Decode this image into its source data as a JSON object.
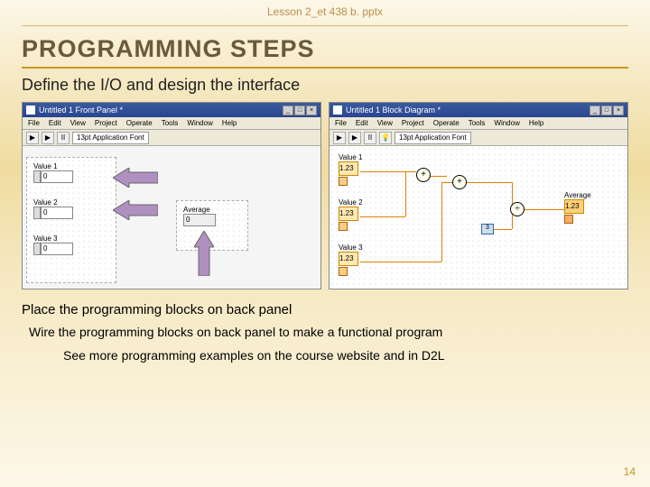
{
  "header": {
    "file": "Lesson 2_et 438 b. pptx"
  },
  "title": "PROGRAMMING STEPS",
  "subtitle": "Define the I/O and design the interface",
  "front": {
    "title": "Untitled 1 Front Panel *",
    "menu": [
      "File",
      "Edit",
      "View",
      "Project",
      "Operate",
      "Tools",
      "Window",
      "Help"
    ],
    "font": "13pt Application Font",
    "v1": {
      "label": "Value 1",
      "val": "0"
    },
    "v2": {
      "label": "Value 2",
      "val": "0"
    },
    "v3": {
      "label": "Value 3",
      "val": "0"
    },
    "avg": {
      "label": "Average",
      "val": "0"
    }
  },
  "block": {
    "title": "Untitled 1 Block Diagram *",
    "menu": [
      "File",
      "Edit",
      "View",
      "Project",
      "Operate",
      "Tools",
      "Window",
      "Help"
    ],
    "font": "13pt Application Font",
    "v1": {
      "label": "Value 1",
      "io": "1.23"
    },
    "v2": {
      "label": "Value 2",
      "io": "1.23"
    },
    "v3": {
      "label": "Value 3",
      "io": "1.23"
    },
    "avg": {
      "label": "Average",
      "io": "1.23"
    },
    "const": "3"
  },
  "captions": {
    "place": "Place the programming blocks on back panel",
    "wire": "Wire the programming blocks on back panel to make a functional program",
    "see": "See more programming examples on the course website and in D2L"
  },
  "page": "14",
  "glyph": {
    "run": "▶",
    "pause": "II",
    "min": "_",
    "max": "□",
    "close": "×",
    "plus": "+",
    "div": "÷"
  }
}
